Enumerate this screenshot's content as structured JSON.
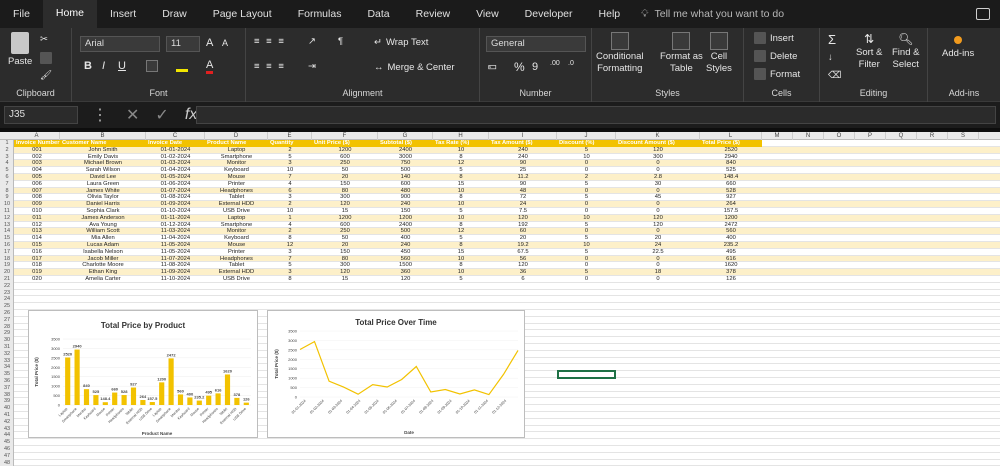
{
  "menu": {
    "tabs": [
      "File",
      "Home",
      "Insert",
      "Draw",
      "Page Layout",
      "Formulas",
      "Data",
      "Review",
      "View",
      "Developer",
      "Help"
    ],
    "active": "Home",
    "tellme": "Tell me what you want to do"
  },
  "ribbon": {
    "clipboard": {
      "label": "Clipboard",
      "paste": "Paste"
    },
    "font": {
      "label": "Font",
      "name": "Arial",
      "size": "11"
    },
    "alignment": {
      "label": "Alignment",
      "wrap": "Wrap Text",
      "merge": "Merge & Center"
    },
    "number": {
      "label": "Number",
      "format": "General"
    },
    "styles": {
      "label": "Styles",
      "cond1": "Conditional",
      "cond2": "Formatting",
      "table1": "Format as",
      "table2": "Table",
      "cell1": "Cell",
      "cell2": "Styles"
    },
    "cells": {
      "label": "Cells",
      "insert": "Insert",
      "delete": "Delete",
      "format": "Format"
    },
    "editing": {
      "label": "Editing",
      "sort1": "Sort &",
      "sort2": "Filter",
      "find1": "Find &",
      "find2": "Select"
    },
    "addins": {
      "label": "Add-ins",
      "btn": "Add-ins"
    }
  },
  "formula_bar": {
    "name_box": "J35",
    "fx": "fx"
  },
  "columns": [
    "A",
    "B",
    "C",
    "D",
    "E",
    "F",
    "G",
    "H",
    "I",
    "J",
    "K",
    "L",
    "M",
    "N",
    "O",
    "P",
    "Q",
    "R",
    "S"
  ],
  "table": {
    "headers": [
      "Invoice Number",
      "Customer Name",
      "Invoice Date",
      "Product Name",
      "Quantity",
      "Unit Price ($)",
      "Subtotal ($)",
      "Tax Rate (%)",
      "Tax Amount ($)",
      "Discount (%)",
      "Discount Amount ($)",
      "Total Price ($)"
    ],
    "rows": [
      [
        "001",
        "John Smith",
        "01-01-2024",
        "Laptop",
        "2",
        "1200",
        "2400",
        "10",
        "240",
        "5",
        "120",
        "2520"
      ],
      [
        "002",
        "Emily Davis",
        "01-02-2024",
        "Smartphone",
        "5",
        "600",
        "3000",
        "8",
        "240",
        "10",
        "300",
        "2940"
      ],
      [
        "003",
        "Michael Brown",
        "01-03-2024",
        "Monitor",
        "3",
        "250",
        "750",
        "12",
        "90",
        "0",
        "0",
        "840"
      ],
      [
        "004",
        "Sarah Wilson",
        "01-04-2024",
        "Keyboard",
        "10",
        "50",
        "500",
        "5",
        "25",
        "0",
        "0",
        "525"
      ],
      [
        "005",
        "David Lee",
        "01-05-2024",
        "Mouse",
        "7",
        "20",
        "140",
        "8",
        "11.2",
        "2",
        "2.8",
        "148.4"
      ],
      [
        "006",
        "Laura Green",
        "01-06-2024",
        "Printer",
        "4",
        "150",
        "600",
        "15",
        "90",
        "5",
        "30",
        "660"
      ],
      [
        "007",
        "James White",
        "01-07-2024",
        "Headphones",
        "6",
        "80",
        "480",
        "10",
        "48",
        "0",
        "0",
        "528"
      ],
      [
        "008",
        "Olivia Taylor",
        "01-08-2024",
        "Tablet",
        "3",
        "300",
        "900",
        "8",
        "72",
        "5",
        "45",
        "927"
      ],
      [
        "009",
        "Daniel Harris",
        "01-09-2024",
        "External HDD",
        "2",
        "120",
        "240",
        "10",
        "24",
        "0",
        "0",
        "264"
      ],
      [
        "010",
        "Sophia Clark",
        "01-10-2024",
        "USB Drive",
        "10",
        "15",
        "150",
        "5",
        "7.5",
        "0",
        "0",
        "157.5"
      ],
      [
        "011",
        "James Anderson",
        "01-11-2024",
        "Laptop",
        "1",
        "1200",
        "1200",
        "10",
        "120",
        "10",
        "120",
        "1200"
      ],
      [
        "012",
        "Ava Young",
        "01-12-2024",
        "Smartphone",
        "4",
        "600",
        "2400",
        "8",
        "192",
        "5",
        "120",
        "2472"
      ],
      [
        "013",
        "William Scott",
        "11-03-2024",
        "Monitor",
        "2",
        "250",
        "500",
        "12",
        "60",
        "0",
        "0",
        "560"
      ],
      [
        "014",
        "Mia Allen",
        "11-04-2024",
        "Keyboard",
        "8",
        "50",
        "400",
        "5",
        "20",
        "5",
        "20",
        "400"
      ],
      [
        "015",
        "Lucas Adam",
        "11-05-2024",
        "Mouse",
        "12",
        "20",
        "240",
        "8",
        "19.2",
        "10",
        "24",
        "235.2"
      ],
      [
        "016",
        "Isabella Nelson",
        "11-05-2024",
        "Printer",
        "3",
        "150",
        "450",
        "15",
        "67.5",
        "5",
        "22.5",
        "495"
      ],
      [
        "017",
        "Jacob Miller",
        "11-07-2024",
        "Headphones",
        "7",
        "80",
        "560",
        "10",
        "56",
        "0",
        "0",
        "616"
      ],
      [
        "018",
        "Charlotte Moore",
        "11-08-2024",
        "Tablet",
        "5",
        "300",
        "1500",
        "8",
        "120",
        "0",
        "0",
        "1620"
      ],
      [
        "019",
        "Ethan King",
        "11-09-2024",
        "External HDD",
        "3",
        "120",
        "360",
        "10",
        "36",
        "5",
        "18",
        "378"
      ],
      [
        "020",
        "Amelia Carter",
        "11-10-2024",
        "USB Drive",
        "8",
        "15",
        "120",
        "5",
        "6",
        "0",
        "0",
        "126"
      ]
    ]
  },
  "colors": {
    "accent": "#f2c200",
    "stripe": "#fdf0c9",
    "line": "#f2c200"
  },
  "chart_data": [
    {
      "type": "bar",
      "title": "Total Price by Product",
      "xlabel": "Product Name",
      "ylabel": "Total Price ($)",
      "ylim": [
        0,
        3500
      ],
      "yticks": [
        0,
        500,
        1000,
        1500,
        2000,
        2500,
        3000,
        3500
      ],
      "categories": [
        "Laptop",
        "Smartphone",
        "Monitor",
        "Keyboard",
        "Mouse",
        "Printer",
        "Headphones",
        "Tablet",
        "External HDD",
        "USB Drive",
        "Laptop",
        "Smartphone",
        "Monitor",
        "Keyboard",
        "Mouse",
        "Printer",
        "Headphones",
        "Tablet",
        "External HDD",
        "USB Drive"
      ],
      "values": [
        2520,
        2940,
        840,
        525,
        148.4,
        660,
        528,
        927,
        264,
        157.5,
        1200,
        2472,
        560,
        400,
        235.2,
        495,
        616,
        1620,
        378,
        126
      ],
      "labels": [
        "2520",
        "2940",
        "840",
        "525",
        "148.4",
        "660",
        "528",
        "927",
        "264",
        "157.5",
        "1200",
        "2472",
        "560",
        "400",
        "235.2",
        "495",
        "616",
        "1620",
        "378",
        "126"
      ]
    },
    {
      "type": "line",
      "title": "Total Price Over Time",
      "xlabel": "Date",
      "ylabel": "Total Price ($)",
      "ylim": [
        0,
        3500
      ],
      "yticks": [
        0,
        500,
        1000,
        1500,
        2000,
        2500,
        3000,
        3500
      ],
      "xticks": [
        "01-01-2024",
        "01-02-2024",
        "01-03-2024",
        "01-04-2024",
        "01-05-2024",
        "01-06-2024",
        "01-07-2024",
        "01-08-2024",
        "01-09-2024",
        "01-10-2024",
        "01-11-2024",
        "01-12-2024"
      ],
      "values": [
        2520,
        2940,
        840,
        525,
        148.4,
        660,
        528,
        927,
        1620,
        264,
        400,
        157.5,
        378,
        126,
        1200,
        2472
      ]
    }
  ]
}
